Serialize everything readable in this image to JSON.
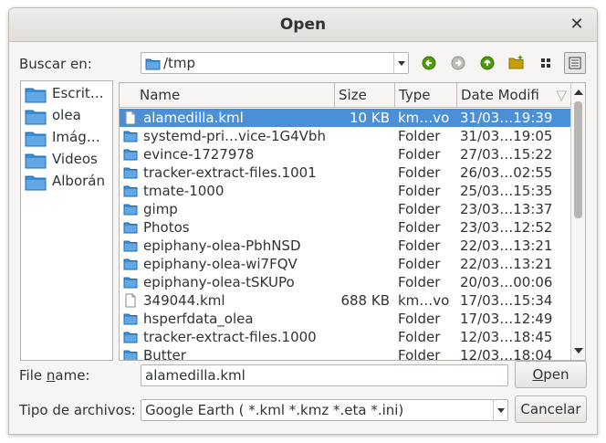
{
  "window": {
    "title": "Open",
    "close_glyph": "✕"
  },
  "location": {
    "label": "Buscar en:",
    "path": "/tmp"
  },
  "toolbar": {
    "icons": [
      "go-back-icon",
      "go-forward-icon",
      "go-up-icon",
      "new-folder-icon",
      "list-view-icon",
      "detail-view-icon"
    ]
  },
  "places": [
    {
      "label": "Escrit…"
    },
    {
      "label": "olea"
    },
    {
      "label": "Imág…"
    },
    {
      "label": "Videos"
    },
    {
      "label": "Alborán"
    }
  ],
  "columns": {
    "name": "Name",
    "size": "Size",
    "type": "Type",
    "date": "Date Modifi"
  },
  "files": [
    {
      "name": "alamedilla.kml",
      "size": "10 KB",
      "type": "km…vo",
      "date": "31/03…19:39",
      "icon": "file-icon",
      "selected": true
    },
    {
      "name": "systemd-pri…vice-1G4Vbh",
      "size": "",
      "type": "Folder",
      "date": "31/03…19:05",
      "icon": "folder-icon"
    },
    {
      "name": "evince-1727978",
      "size": "",
      "type": "Folder",
      "date": "27/03…15:22",
      "icon": "folder-icon"
    },
    {
      "name": "tracker-extract-files.1001",
      "size": "",
      "type": "Folder",
      "date": "26/03…02:55",
      "icon": "folder-icon"
    },
    {
      "name": "tmate-1000",
      "size": "",
      "type": "Folder",
      "date": "25/03…15:35",
      "icon": "folder-icon"
    },
    {
      "name": "gimp",
      "size": "",
      "type": "Folder",
      "date": "23/03…13:37",
      "icon": "folder-icon"
    },
    {
      "name": "Photos",
      "size": "",
      "type": "Folder",
      "date": "23/03…12:52",
      "icon": "folder-icon"
    },
    {
      "name": "epiphany-olea-PbhNSD",
      "size": "",
      "type": "Folder",
      "date": "22/03…13:21",
      "icon": "folder-icon"
    },
    {
      "name": "epiphany-olea-wi7FQV",
      "size": "",
      "type": "Folder",
      "date": "22/03…13:21",
      "icon": "folder-icon"
    },
    {
      "name": "epiphany-olea-tSKUPo",
      "size": "",
      "type": "Folder",
      "date": "20/03…00:06",
      "icon": "folder-icon"
    },
    {
      "name": "349044.kml",
      "size": "688 KB",
      "type": "km…vo",
      "date": "17/03…15:34",
      "icon": "file-icon"
    },
    {
      "name": "hsperfdata_olea",
      "size": "",
      "type": "Folder",
      "date": "17/03…12:49",
      "icon": "folder-icon"
    },
    {
      "name": "tracker-extract-files.1000",
      "size": "",
      "type": "Folder",
      "date": "12/03…18:45",
      "icon": "folder-icon"
    },
    {
      "name": "Butter",
      "size": "",
      "type": "Folder",
      "date": "12/03…18:04",
      "icon": "folder-icon"
    }
  ],
  "filename": {
    "label_pre": "File ",
    "label_u": "n",
    "label_post": "ame:",
    "value": "alamedilla.kml"
  },
  "filetype": {
    "label": "Tipo de archivos:",
    "value": "Google Earth ( *.kml *.kmz *.eta *.ini)"
  },
  "buttons": {
    "open_u": "O",
    "open_rest": "pen",
    "cancel": "Cancelar"
  },
  "colors": {
    "selection": "#4a90d9",
    "folder": "#3d8fd1",
    "nav_green": "#4e9a06"
  }
}
